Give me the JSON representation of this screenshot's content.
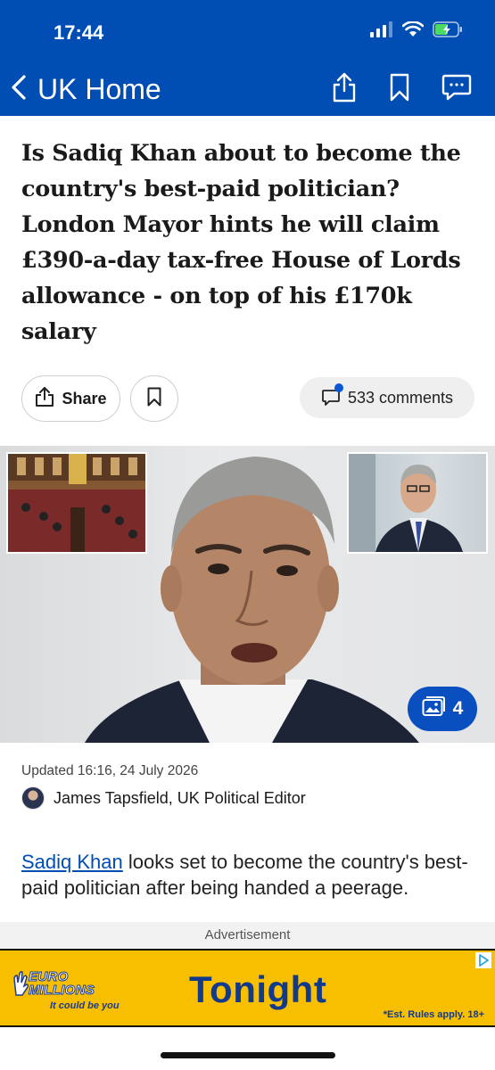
{
  "status_bar": {
    "time": "17:44"
  },
  "nav": {
    "back_label": "UK Home"
  },
  "article": {
    "headline": "Is Sadiq Khan about to become the country's best-paid politician? London Mayor hints he will claim £390-a-day tax-free House of Lords allowance - on top of his £170k salary",
    "share_label": "Share",
    "comments_label": "533 comments",
    "gallery_count": "4",
    "updated": "Updated 16:16, 24 July 2026",
    "author": "James Tapsfield, UK Political Editor",
    "body_link": "Sadiq Khan",
    "body_rest": " looks set to become the country's best-paid politician after being handed a peerage."
  },
  "ad": {
    "label": "Advertisement",
    "brand_line1": "EURO",
    "brand_line2": "MILLIONS",
    "tagline": "It could be you",
    "headline": "Tonight",
    "rules": "*Est. Rules apply. 18+"
  },
  "colors": {
    "brand_blue": "#004db3",
    "ad_yellow": "#f7bf00",
    "ad_blue": "#123a8c"
  },
  "icons": [
    "signal-icon",
    "wifi-icon",
    "battery-icon",
    "back-chevron-icon",
    "share-icon",
    "bookmark-icon",
    "comment-icon",
    "gallery-icon"
  ]
}
